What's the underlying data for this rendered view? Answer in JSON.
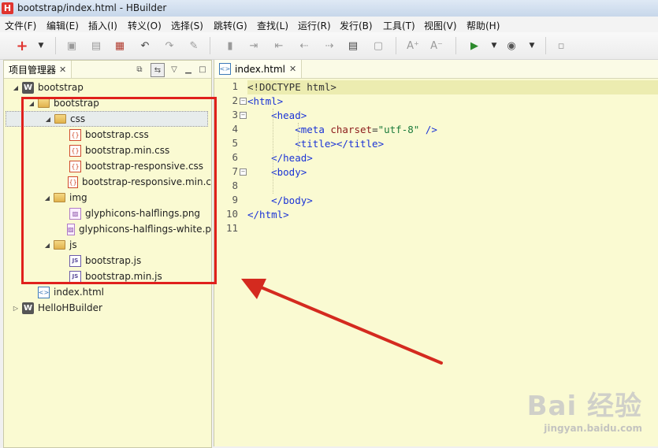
{
  "window": {
    "title": "bootstrap/index.html  -  HBuilder",
    "app_logo": "H"
  },
  "menu": [
    "文件(F)",
    "编辑(E)",
    "插入(I)",
    "转义(O)",
    "选择(S)",
    "跳转(G)",
    "查找(L)",
    "运行(R)",
    "发行(B)",
    "工具(T)",
    "视图(V)",
    "帮助(H)"
  ],
  "toolbar": {
    "new_glyph": "+",
    "icons": [
      "new-icon",
      "dropdown-icon",
      "save-icon",
      "save-all-icon",
      "history-icon",
      "undo-icon",
      "redo-icon",
      "bookmark-icon",
      "indent-icon",
      "outdent-icon",
      "move-left-icon",
      "move-right-icon",
      "comment-icon",
      "uncomment-icon",
      "font-size-icon",
      "font-smaller-icon",
      "run-icon",
      "run-dropdown-icon",
      "browser-icon",
      "browser-dropdown-icon",
      "snippet-icon"
    ]
  },
  "project_panel": {
    "tab_label": "项目管理器",
    "tree": [
      {
        "label": "bootstrap",
        "type": "project",
        "expanded": true,
        "level": 0
      },
      {
        "label": "bootstrap",
        "type": "folder",
        "expanded": true,
        "level": 1
      },
      {
        "label": "css",
        "type": "folder",
        "expanded": true,
        "level": 2,
        "selected": true
      },
      {
        "label": "bootstrap.css",
        "type": "css",
        "level": 3
      },
      {
        "label": "bootstrap.min.css",
        "type": "css",
        "level": 3
      },
      {
        "label": "bootstrap-responsive.css",
        "type": "css",
        "level": 3
      },
      {
        "label": "bootstrap-responsive.min.c",
        "type": "css",
        "level": 3
      },
      {
        "label": "img",
        "type": "folder",
        "expanded": true,
        "level": 2
      },
      {
        "label": "glyphicons-halflings.png",
        "type": "png",
        "level": 3
      },
      {
        "label": "glyphicons-halflings-white.p",
        "type": "png",
        "level": 3
      },
      {
        "label": "js",
        "type": "folder",
        "expanded": true,
        "level": 2
      },
      {
        "label": "bootstrap.js",
        "type": "js",
        "level": 3
      },
      {
        "label": "bootstrap.min.js",
        "type": "js",
        "level": 3
      },
      {
        "label": "index.html",
        "type": "html",
        "level": 1
      },
      {
        "label": "HelloHBuilder",
        "type": "project",
        "expanded": false,
        "level": 0
      }
    ]
  },
  "editor": {
    "tab_label": "index.html",
    "lines": [
      {
        "n": "1",
        "text": "<!DOCTYPE html>"
      },
      {
        "n": "2",
        "text": "<html>"
      },
      {
        "n": "3",
        "text": "    <head>"
      },
      {
        "n": "4",
        "text": "        <meta charset=\"utf-8\" />"
      },
      {
        "n": "5",
        "text": "        <title></title>"
      },
      {
        "n": "6",
        "text": "    </head>"
      },
      {
        "n": "7",
        "text": "    <body>"
      },
      {
        "n": "8",
        "text": ""
      },
      {
        "n": "9",
        "text": "    </body>"
      },
      {
        "n": "10",
        "text": "</html>"
      },
      {
        "n": "11",
        "text": ""
      }
    ]
  },
  "watermark": {
    "main": "Bai 经验",
    "sub": "jingyan.baidu.com"
  },
  "colors": {
    "editor_bg": "#fafad2",
    "callout": "#e0201c",
    "tag": "#1a33d6",
    "attr": "#8b1a1a",
    "value": "#1a7a3a"
  }
}
